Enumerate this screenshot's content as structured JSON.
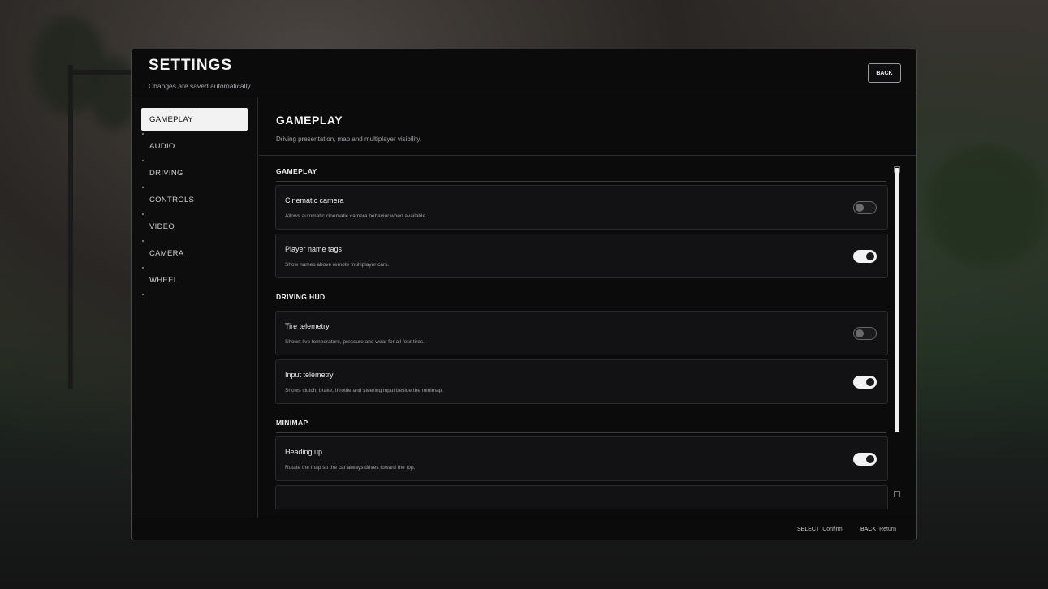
{
  "header": {
    "title": "SETTINGS",
    "subtitle": "Changes are saved automatically",
    "back_label": "BACK"
  },
  "sidebar": {
    "items": [
      {
        "label": "GAMEPLAY",
        "active": true
      },
      {
        "label": "AUDIO",
        "active": false
      },
      {
        "label": "DRIVING",
        "active": false
      },
      {
        "label": "CONTROLS",
        "active": false
      },
      {
        "label": "VIDEO",
        "active": false
      },
      {
        "label": "CAMERA",
        "active": false
      },
      {
        "label": "WHEEL",
        "active": false
      }
    ]
  },
  "content": {
    "title": "GAMEPLAY",
    "description": "Driving presentation, map and multiplayer visibility.",
    "sections": [
      {
        "title": "GAMEPLAY",
        "rows": [
          {
            "label": "Cinematic camera",
            "description": "Allows automatic cinematic camera behavior when available.",
            "enabled": false
          },
          {
            "label": "Player name tags",
            "description": "Show names above remote multiplayer cars.",
            "enabled": true
          }
        ]
      },
      {
        "title": "DRIVING HUD",
        "rows": [
          {
            "label": "Tire telemetry",
            "description": "Shows live temperature, pressure and wear for all four tires.",
            "enabled": false
          },
          {
            "label": "Input telemetry",
            "description": "Shows clutch, brake, throttle and steering input beside the minimap.",
            "enabled": true
          }
        ]
      },
      {
        "title": "MINIMAP",
        "rows": [
          {
            "label": "Heading up",
            "description": "Rotate the map so the car always drives toward the top.",
            "enabled": true
          }
        ]
      }
    ]
  },
  "footer": {
    "hints": [
      {
        "key": "SELECT",
        "action": "Confirm"
      },
      {
        "key": "BACK",
        "action": "Return"
      }
    ]
  },
  "colors": {
    "accent": "#f2f2f2",
    "panel_bg": "#0b0b0c",
    "row_bg": "#121214"
  }
}
